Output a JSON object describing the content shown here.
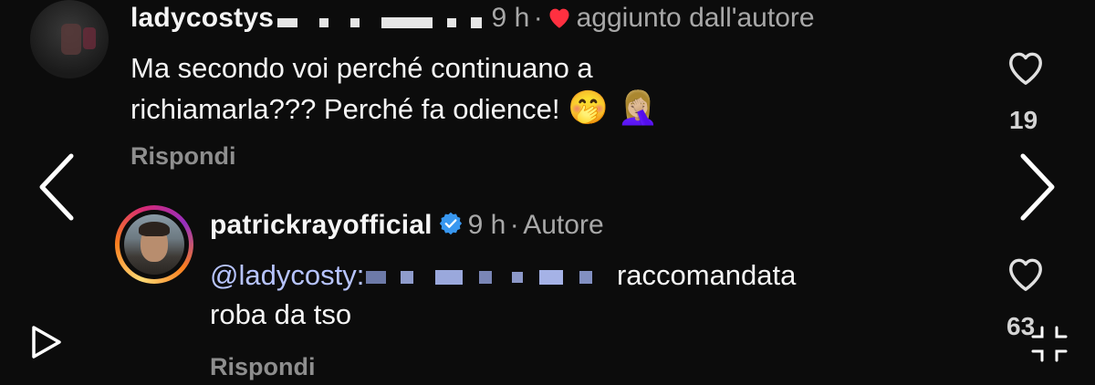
{
  "comment1": {
    "username": "ladycostys",
    "time": "9 h",
    "separator": "·",
    "liked_by_author": "aggiunto dall'autore",
    "text_line1": "Ma secondo voi perché continuano a",
    "text_line2": "richiamarla??? Perché fa odience!",
    "emojis": "🤭 🤦🏼‍♀️",
    "reply_label": "Rispondi",
    "like_count": "19"
  },
  "comment2": {
    "username": "patrickrayofficial",
    "time": "9 h",
    "separator": "·",
    "role": "Autore",
    "mention": "@ladycosty:",
    "text_line1_end": "raccomandata",
    "text_line2": "roba da tso",
    "reply_label": "Rispondi",
    "like_count": "63"
  },
  "colors": {
    "background": "#0c0c0c",
    "heart_red": "#ff3040",
    "verified_blue": "#3897f0",
    "mention": "#b7c4ff"
  },
  "icons": [
    "chevron-left-icon",
    "chevron-right-icon",
    "heart-icon",
    "verified-badge-icon",
    "play-icon",
    "collapse-icon"
  ]
}
